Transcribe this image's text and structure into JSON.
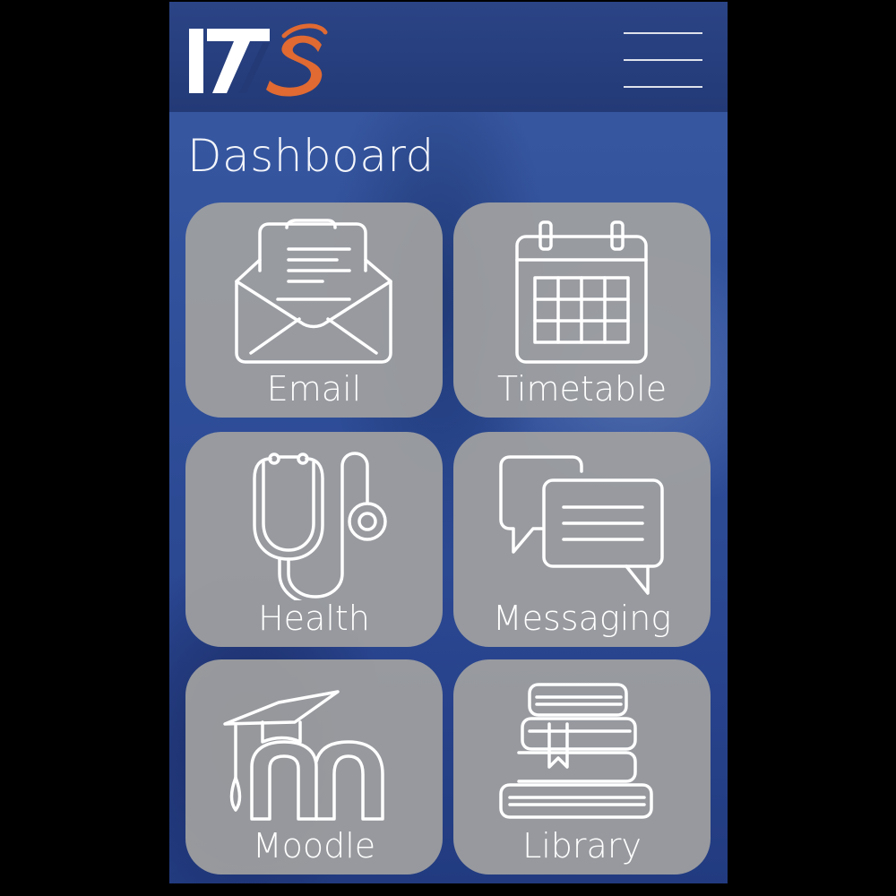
{
  "header": {
    "logo_alt": "ITS",
    "menu_icon": "hamburger-menu-icon"
  },
  "page": {
    "title": "Dashboard"
  },
  "tiles": [
    {
      "label": "Email",
      "icon": "envelope-letter-icon"
    },
    {
      "label": "Timetable",
      "icon": "calendar-icon"
    },
    {
      "label": "Health",
      "icon": "stethoscope-icon"
    },
    {
      "label": "Messaging",
      "icon": "chat-bubbles-icon"
    },
    {
      "label": "Moodle",
      "icon": "moodle-logo-icon"
    },
    {
      "label": "Library",
      "icon": "stacked-books-icon"
    }
  ],
  "colors": {
    "header_bg": "#233a77",
    "background": "#2f4f9a",
    "tile_bg": "#a0a0a0",
    "logo_accent": "#e06a32",
    "text": "#ffffff"
  }
}
